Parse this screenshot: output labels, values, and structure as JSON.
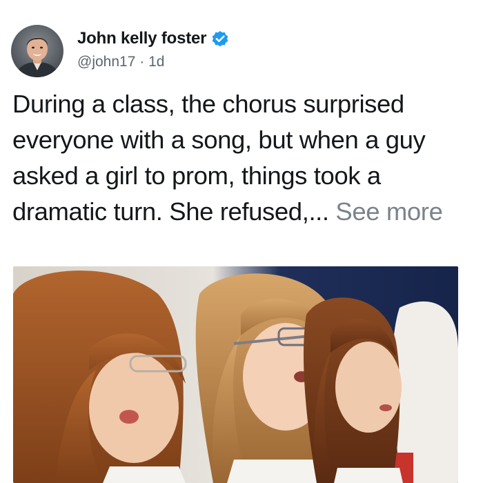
{
  "author": {
    "display_name": "John kelly foster",
    "handle": "@john17",
    "separator": "·",
    "time": "1d",
    "verified_icon": "verified-badge-icon",
    "avatar_icon": "profile-photo"
  },
  "tweet": {
    "text": "During a class, the chorus surprised everyone with a song, but when a guy asked a girl to prom, things took a dramatic turn. She refused,...",
    "see_more_label": "See more"
  },
  "media": {
    "description_icon": "photo-three-girls-singing-choir"
  },
  "colors": {
    "text": "#14171a",
    "secondary": "#5b6670",
    "verified": "#1d9bf0",
    "see_more": "#7a838c"
  }
}
